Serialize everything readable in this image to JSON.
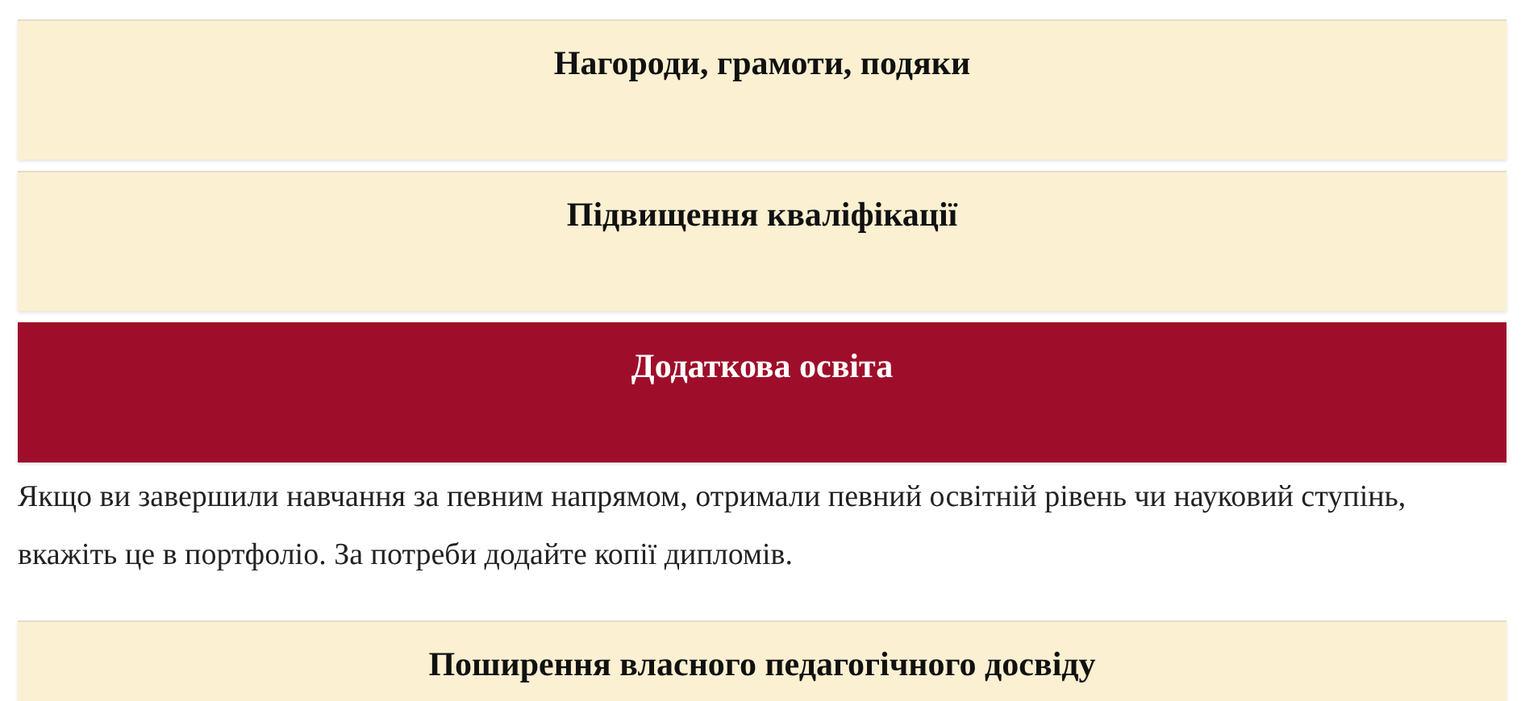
{
  "sections": [
    {
      "title": "Нагороди, грамоти, подяки",
      "expanded": false
    },
    {
      "title": "Підвищення кваліфікації",
      "expanded": false
    },
    {
      "title": "Додаткова освіта",
      "expanded": true,
      "text": "Якщо ви завершили навчання за певним напрямом, отримали певний освітній рівень чи науковий ступінь, вкажіть це в портфоліо. За потреби додайте копії дипломів."
    },
    {
      "title": "Поширення власного педагогічного досвіду",
      "expanded": false
    }
  ]
}
